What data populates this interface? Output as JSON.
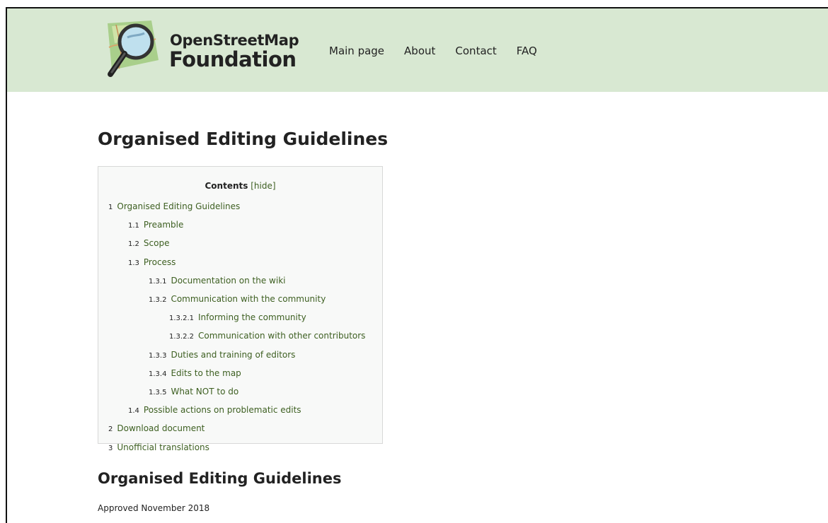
{
  "header": {
    "logo_line1": "OpenStreetMap",
    "logo_line2": "Foundation",
    "nav": [
      "Main page",
      "About",
      "Contact",
      "FAQ"
    ]
  },
  "page": {
    "title": "Organised Editing Guidelines",
    "toc": {
      "title": "Contents",
      "toggle": "[hide]",
      "items": [
        {
          "num": "1",
          "label": "Organised Editing Guidelines",
          "level": 1
        },
        {
          "num": "1.1",
          "label": "Preamble",
          "level": 2
        },
        {
          "num": "1.2",
          "label": "Scope",
          "level": 2
        },
        {
          "num": "1.3",
          "label": "Process",
          "level": 2
        },
        {
          "num": "1.3.1",
          "label": "Documentation on the wiki",
          "level": 3
        },
        {
          "num": "1.3.2",
          "label": "Communication with the community",
          "level": 3
        },
        {
          "num": "1.3.2.1",
          "label": "Informing the community",
          "level": 4
        },
        {
          "num": "1.3.2.2",
          "label": "Communication with other contributors",
          "level": 4
        },
        {
          "num": "1.3.3",
          "label": "Duties and training of editors",
          "level": 3
        },
        {
          "num": "1.3.4",
          "label": "Edits to the map",
          "level": 3
        },
        {
          "num": "1.3.5",
          "label": "What NOT to do",
          "level": 3
        },
        {
          "num": "1.4",
          "label": "Possible actions on problematic edits",
          "level": 2
        },
        {
          "num": "2",
          "label": "Download document",
          "level": 1
        },
        {
          "num": "3",
          "label": "Unofficial translations",
          "level": 1
        }
      ]
    },
    "section_title": "Organised Editing Guidelines",
    "approved": "Approved November 2018"
  },
  "colors": {
    "header_bg": "#d8e8d2",
    "link": "#3d5f21",
    "toc_bg": "#f8f9f8"
  }
}
